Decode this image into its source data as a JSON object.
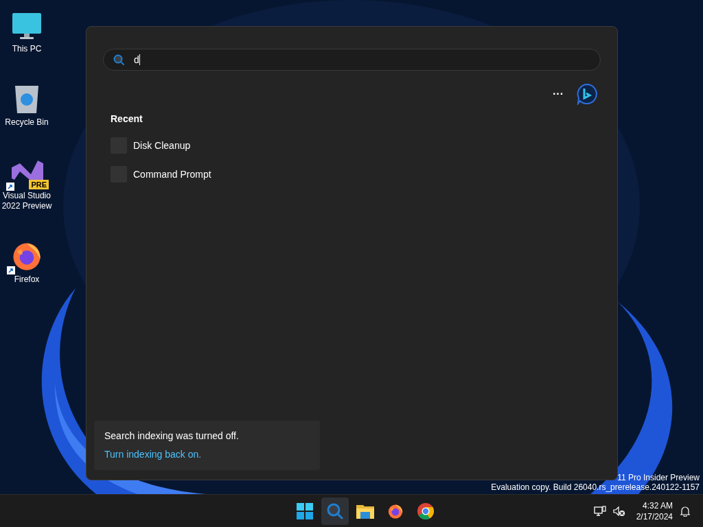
{
  "desktop_icons": [
    {
      "kind": "pc",
      "label": "This PC",
      "shortcut": false
    },
    {
      "kind": "bin",
      "label": "Recycle Bin",
      "shortcut": false
    },
    {
      "kind": "vs",
      "label": "Visual Studio 2022 Preview",
      "badge": "PRE",
      "shortcut": true
    },
    {
      "kind": "firefox",
      "label": "Firefox",
      "shortcut": true
    }
  ],
  "search": {
    "value": "d"
  },
  "more_button": "···",
  "recent": {
    "heading": "Recent",
    "items": [
      {
        "label": "Disk Cleanup"
      },
      {
        "label": "Command Prompt"
      }
    ]
  },
  "notice": {
    "text": "Search indexing was turned off.",
    "link": "Turn indexing back on."
  },
  "watermark": [
    "11 Pro Insider Preview",
    "Evaluation copy. Build 26040.rs_prerelease.240122-1157"
  ],
  "taskbar": {
    "apps": [
      {
        "kind": "start",
        "selected": false
      },
      {
        "kind": "search",
        "selected": true
      },
      {
        "kind": "folder",
        "selected": false
      },
      {
        "kind": "firefox",
        "selected": false
      },
      {
        "kind": "chrome",
        "selected": false
      }
    ],
    "time": "4:32 AM",
    "date": "2/17/2024"
  }
}
